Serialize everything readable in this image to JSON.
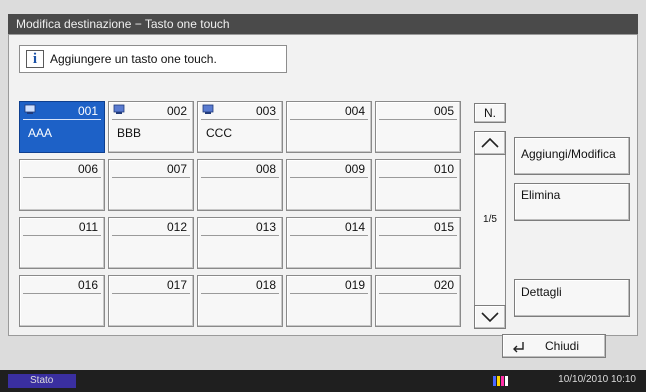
{
  "window": {
    "title": "Modifica destinazione − Tasto one touch"
  },
  "message": {
    "text": "Aggiungere un tasto one touch."
  },
  "keys": [
    {
      "num": "001",
      "name": "AAA",
      "selected": true,
      "has_icon": true
    },
    {
      "num": "002",
      "name": "BBB",
      "selected": false,
      "has_icon": true
    },
    {
      "num": "003",
      "name": "CCC",
      "selected": false,
      "has_icon": true
    },
    {
      "num": "004",
      "name": "",
      "selected": false,
      "has_icon": false
    },
    {
      "num": "005",
      "name": "",
      "selected": false,
      "has_icon": false
    },
    {
      "num": "006",
      "name": "",
      "selected": false,
      "has_icon": false
    },
    {
      "num": "007",
      "name": "",
      "selected": false,
      "has_icon": false
    },
    {
      "num": "008",
      "name": "",
      "selected": false,
      "has_icon": false
    },
    {
      "num": "009",
      "name": "",
      "selected": false,
      "has_icon": false
    },
    {
      "num": "010",
      "name": "",
      "selected": false,
      "has_icon": false
    },
    {
      "num": "011",
      "name": "",
      "selected": false,
      "has_icon": false
    },
    {
      "num": "012",
      "name": "",
      "selected": false,
      "has_icon": false
    },
    {
      "num": "013",
      "name": "",
      "selected": false,
      "has_icon": false
    },
    {
      "num": "014",
      "name": "",
      "selected": false,
      "has_icon": false
    },
    {
      "num": "015",
      "name": "",
      "selected": false,
      "has_icon": false
    },
    {
      "num": "016",
      "name": "",
      "selected": false,
      "has_icon": false
    },
    {
      "num": "017",
      "name": "",
      "selected": false,
      "has_icon": false
    },
    {
      "num": "018",
      "name": "",
      "selected": false,
      "has_icon": false
    },
    {
      "num": "019",
      "name": "",
      "selected": false,
      "has_icon": false
    },
    {
      "num": "020",
      "name": "",
      "selected": false,
      "has_icon": false
    }
  ],
  "nav": {
    "number_label": "N.",
    "page_indicator": "1/5"
  },
  "actions": {
    "add_edit": "Aggiungi/Modifica",
    "delete": "Elimina",
    "details": "Dettagli",
    "close": "Chiudi"
  },
  "status": {
    "label": "Stato",
    "datetime": "10/10/2010  10:10"
  },
  "colors": {
    "selected": "#1d61c7",
    "titlebar": "#4a4a4a",
    "stato": "#3a2fa0"
  }
}
